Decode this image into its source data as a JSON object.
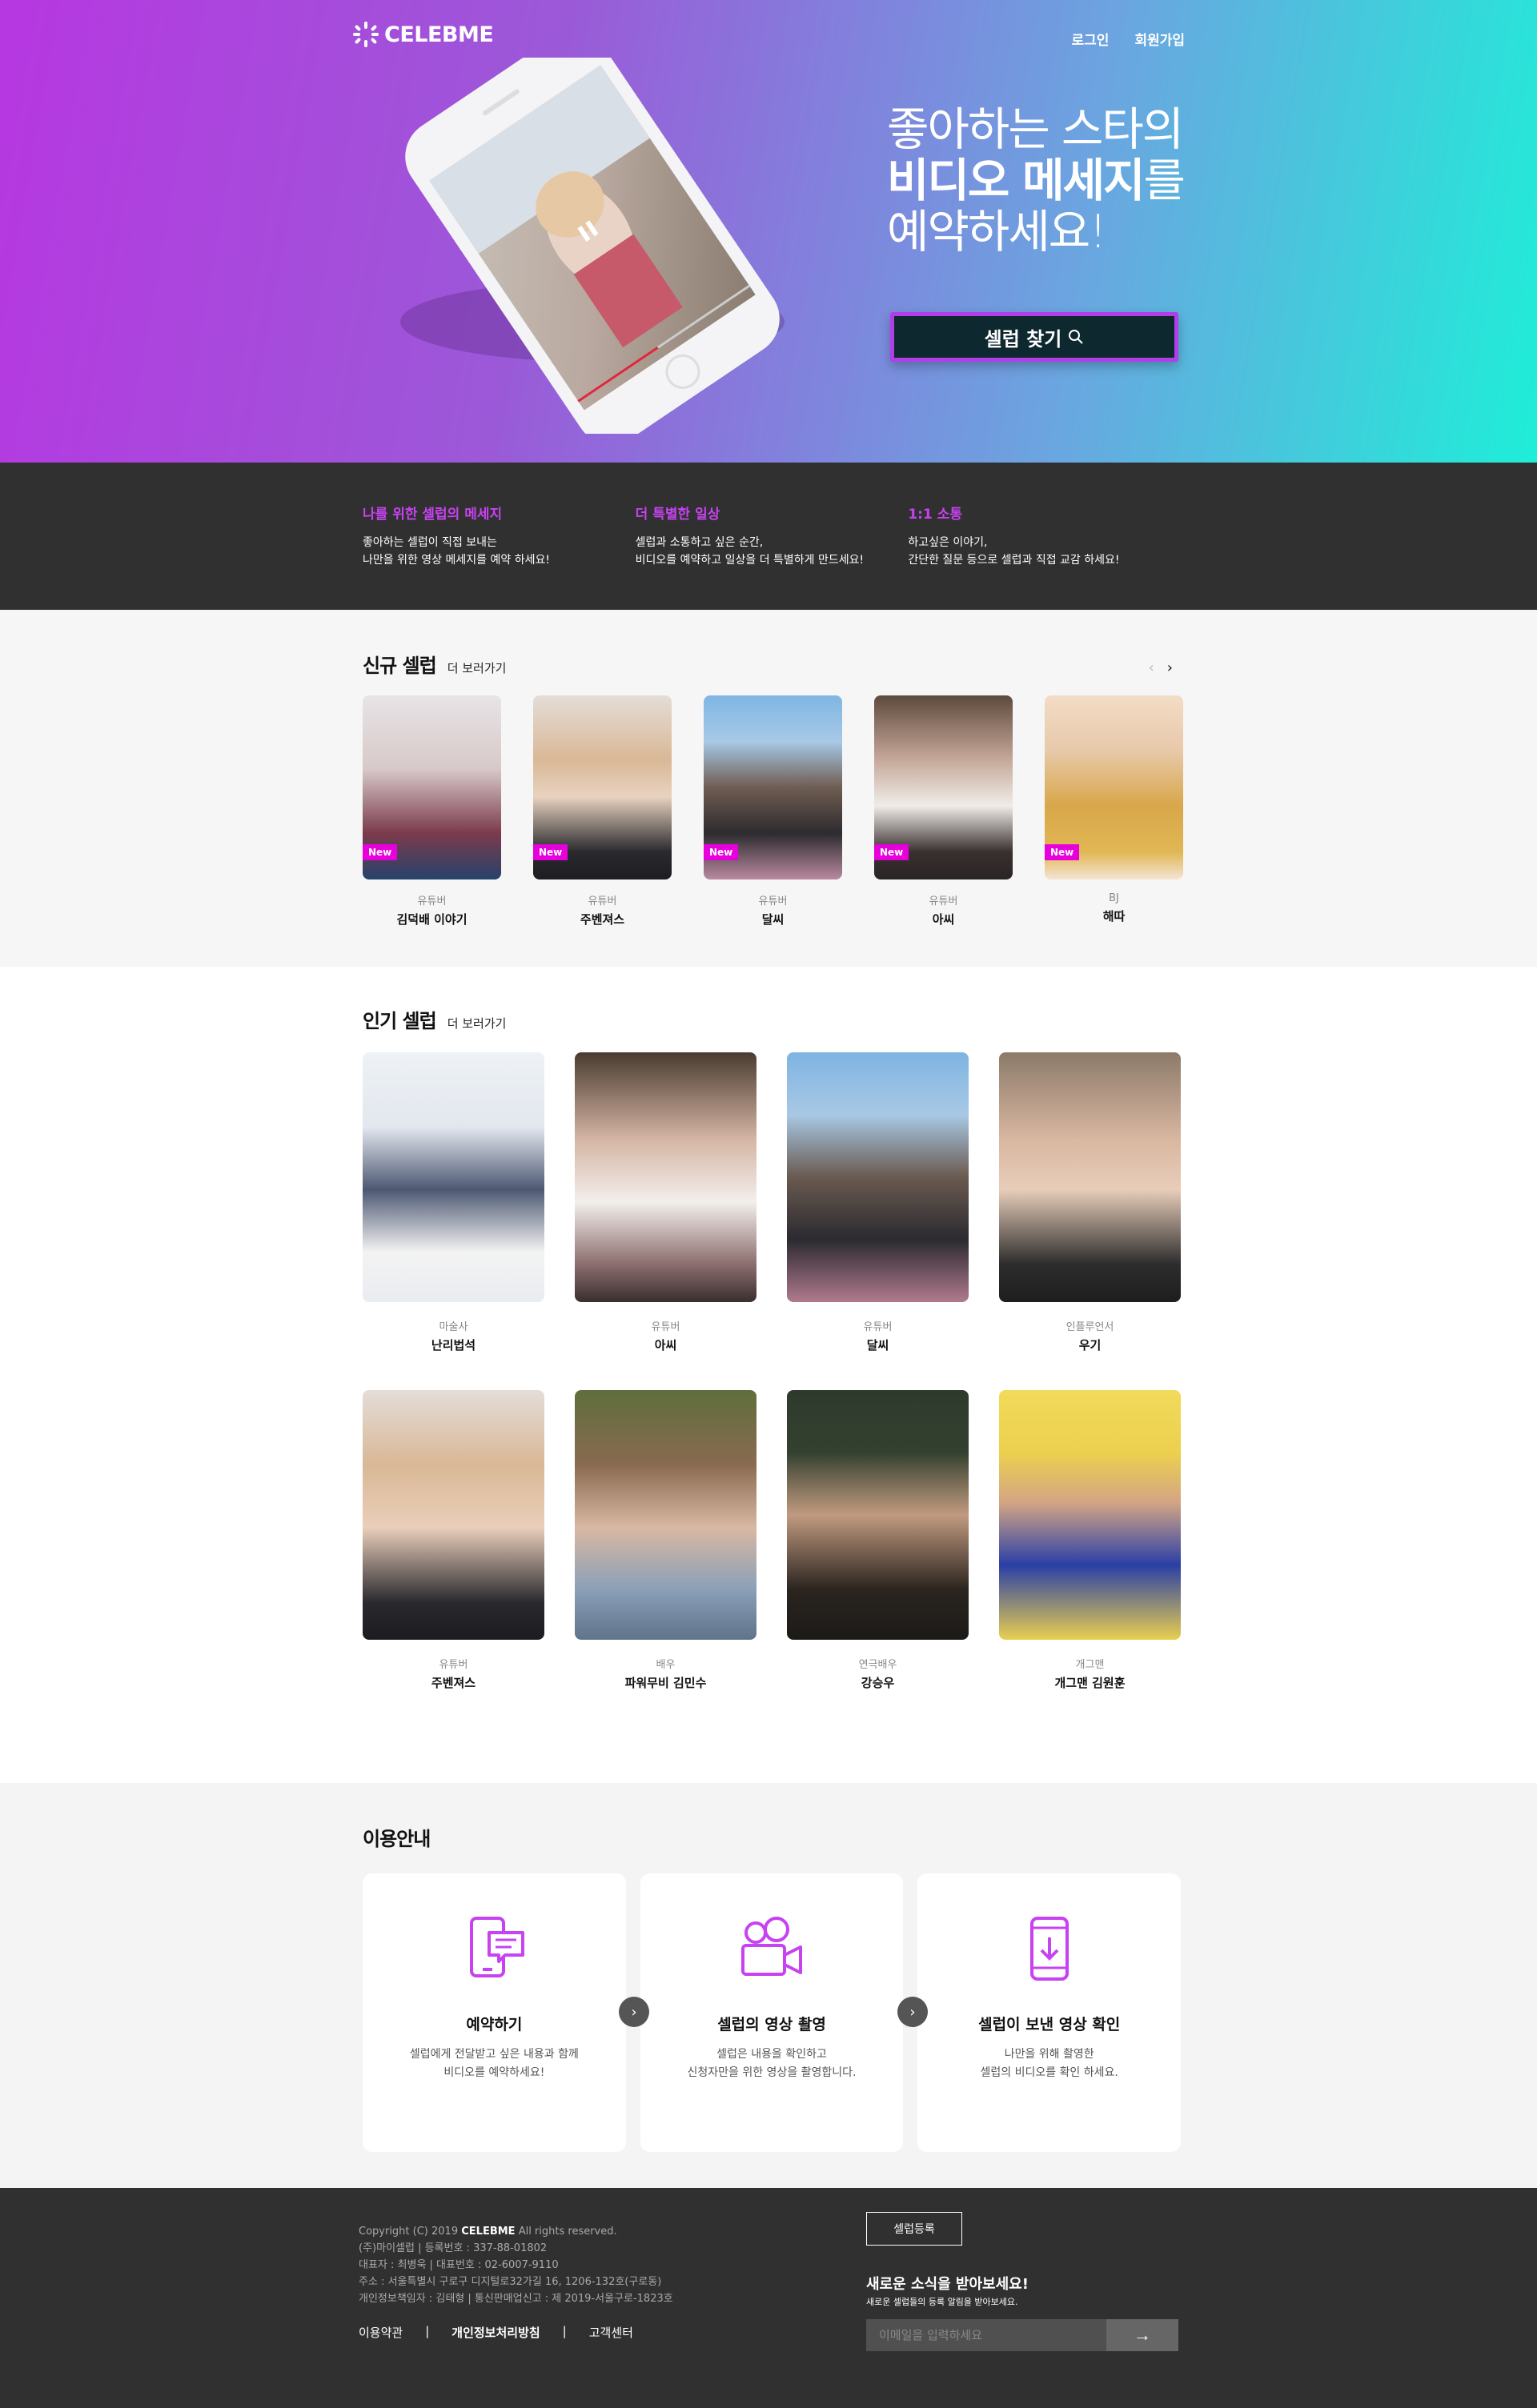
{
  "header": {
    "logo_text": "CELEBME",
    "nav": {
      "login": "로그인",
      "signup": "회원가입"
    }
  },
  "hero": {
    "headline_line1": "좋아하는 스타의",
    "headline_bold": "비디오 메세지",
    "headline_suffix": "를",
    "headline_line3": "예약하세요!",
    "cta_label": "셀럽 찾기",
    "colors": {
      "gradient_start": "#b737e1",
      "gradient_end": "#1eeed8",
      "cta_bg": "#0e2830",
      "cta_border": "#b23ee8"
    }
  },
  "features": [
    {
      "title": "나를 위한 셀럽의 메세지",
      "line1": "좋아하는 셀럽이 직접 보내는",
      "line2": "나만을 위한 영상 메세지를 예약 하세요!"
    },
    {
      "title": "더 특별한 일상",
      "line1": "셀럽과 소통하고 싶은 순간,",
      "line2": "비디오를 예약하고 일상을 더 특별하게 만드세요!"
    },
    {
      "title": "1:1 소통",
      "line1": "하고싶은 이야기,",
      "line2": "간단한 질문 등으로 셀럽과 직접 교감 하세요!"
    }
  ],
  "new_celebs": {
    "title": "신규 셀럽",
    "more": "더 보러가기",
    "badge": "New",
    "items": [
      {
        "category": "유튜버",
        "name": "김덕배 이야기"
      },
      {
        "category": "유튜버",
        "name": "주벤져스"
      },
      {
        "category": "유튜버",
        "name": "달씨"
      },
      {
        "category": "유튜버",
        "name": "아씨"
      },
      {
        "category": "BJ",
        "name": "해따"
      }
    ]
  },
  "popular_celebs": {
    "title": "인기 셀럽",
    "more": "더 보러가기",
    "items": [
      {
        "category": "마술사",
        "name": "난리법석"
      },
      {
        "category": "유튜버",
        "name": "아씨"
      },
      {
        "category": "유튜버",
        "name": "달씨"
      },
      {
        "category": "인플루언서",
        "name": "우기"
      },
      {
        "category": "유튜버",
        "name": "주벤져스"
      },
      {
        "category": "배우",
        "name": "파워무비 김민수"
      },
      {
        "category": "연극배우",
        "name": "강승우"
      },
      {
        "category": "개그맨",
        "name": "개그맨 김원훈"
      }
    ]
  },
  "guide": {
    "title": "이용안내",
    "steps": [
      {
        "icon": "phone-chat-icon",
        "title": "예약하기",
        "line1": "셀럽에게 전달받고 싶은 내용과 함께",
        "line2": "비디오를 예약하세요!"
      },
      {
        "icon": "video-camera-icon",
        "title": "셀럽의 영상 촬영",
        "line1": "셀럽은 내용을 확인하고",
        "line2": "신청자만을 위한 영상을 촬영합니다."
      },
      {
        "icon": "phone-download-icon",
        "title": "셀럽이 보낸 영상 확인",
        "line1": "나만을 위해 촬영한",
        "line2": "셀럽의 비디오를 확인 하세요."
      }
    ]
  },
  "footer": {
    "copyright_prefix": "Copyright (C) 2019",
    "copyright_brand": "CELEBME",
    "copyright_suffix": "All rights reserved.",
    "company": "(주)마이셀럽 | 등록번호 : 337-88-01802",
    "ceo": "대표자 : 최병욱 | 대표번호 : 02-6007-9110",
    "address": "주소 : 서울특별시 구로구 디지털로32가길 16, 1206-132호(구로동)",
    "privacy": "개인정보책임자 : 김태형 | 통신판매업신고 : 제 2019-서울구로-1823호",
    "links": {
      "terms": "이용약관",
      "privacy_policy": "개인정보처리방침",
      "support": "고객센터"
    },
    "register_button": "셀럽등록",
    "newsletter_title": "새로운 소식을 받아보세요!",
    "newsletter_sub": "새로운 셀럽들의 등록 알림을 받아보세요.",
    "email_placeholder": "이메일을 입력하세요",
    "submit_icon": "arrow-right-icon"
  }
}
